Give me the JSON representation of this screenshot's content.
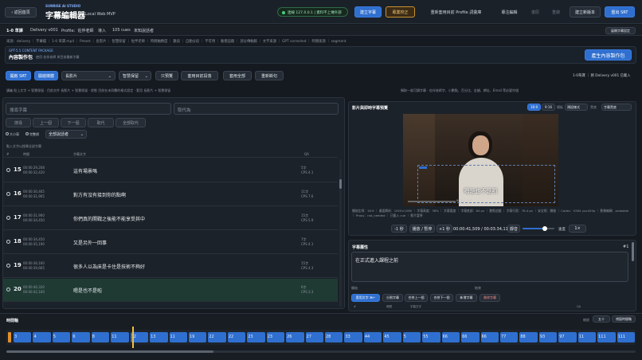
{
  "topbar": {
    "back": "‹ 返回首頁",
    "studio": "SUNRISE AI STUDIO",
    "title": "字幕編輯器",
    "subtitle": "Local Web MVP",
    "status": "連線 127.0.0.1 | 資料不上傳外部",
    "buttons": [
      "建立字幕",
      "專業校正",
      "重新套用目前 Profile 詞彙庫",
      "專注編輯",
      "復原",
      "重做",
      "建立新版本",
      "匯出 SRT"
    ]
  },
  "bar2": {
    "items": [
      "1-0 草譯",
      "Delivery v001",
      "Profile：佐伴老師",
      "導入",
      "105 cues",
      "未知說話者"
    ],
    "right": "展開字幕設定"
  },
  "bar3": {
    "text": "來源：delivery ｜ 字幕檔 ｜ 1-0 草譯.mp4 ｜ Preset ｜ 長影片 ｜ 智慧保留 ｜ 佐伴老師 ｜ 時間軸精度 ｜ 數段 ｜ 自動分段 ｜ 不可用 ｜ 動態追蹤 ｜ 部分傳輸稿 ｜ 文字來源 ｜ GPT corrected ｜ 時間來源 ｜ segment"
  },
  "content": {
    "label": "GPT-5.5 CONTENT PACKAGE",
    "title": "內容製作包",
    "desc": "使用 佐伴老師 與目前最新字幕",
    "button": "產生內容製作包"
  },
  "toolbar": {
    "b1": "開啟 SRT",
    "b2": "開啟媒體",
    "preset": "長影片",
    "keep": "智慧保留",
    "b3": "只預覽",
    "b4": "套用目前段落",
    "b5": "套用全部",
    "b6": "重新斷句",
    "right": "1-0草譯 ｜ 將 Delivery v001 已載入"
  },
  "info": {
    "text": "講義  貼上文字 + 智慧保留  ·  目前文件  長影片 + 智慧保留  ·  狀態  目前在未同覆的格式設定  ·  套用 長影片 + 智慧保留",
    "right": "擷取一般可讀字幕  ·  佐伴老師字、小數點、百分比、金額、網址、Email 等必要符號"
  },
  "search": {
    "placeholder": "搜尋字幕",
    "replace": "取代為",
    "b1": "搜尋",
    "b2": "上一個",
    "b3": "下一個",
    "b4": "取代",
    "b5": "全部取代",
    "opt1": "大小寫",
    "opt2": "完整詞",
    "speaker": "全部說話者",
    "hint": "點入文字以搜尋全部字幕"
  },
  "listhead": {
    "c1": "#",
    "c2": "時間",
    "c3": "字幕文字",
    "c4": "QA"
  },
  "rows": [
    {
      "n": "15",
      "s": "00:00:29,208",
      "e": "00:00:32,420",
      "t": "這有場景嗎",
      "q1": "5字",
      "q2": "CPS 4.1"
    },
    {
      "n": "16",
      "s": "00:00:30,465",
      "e": "00:00:31,905",
      "t": "對方有沒有接到你的點啊",
      "q1": "11字",
      "q2": "CPS 7.6"
    },
    {
      "n": "17",
      "s": "00:00:31,900",
      "e": "00:00:34,450",
      "t": "你們真的開戰之後能不能享受其中",
      "q1": "15字",
      "q2": "CPS 5.9"
    },
    {
      "n": "18",
      "s": "00:00:34,450",
      "e": "00:00:35,190",
      "t": "又是另外一回事",
      "q1": "7字",
      "q2": "CPS 4.1"
    },
    {
      "n": "19",
      "s": "00:00:36,160",
      "e": "00:00:39,665",
      "t": "很多人以為床是卡住是技術不夠好",
      "q1": "15字",
      "q2": "CPS 4.3"
    },
    {
      "n": "20",
      "s": "00:00:40,320",
      "e": "00:00:42,160",
      "t": "嗯是也不是啦",
      "q1": "6字",
      "q2": "CPS 3.3"
    }
  ],
  "video": {
    "title": "影片與即時字幕預覽",
    "tabs": [
      "16:9",
      "9:16"
    ],
    "label1": "模板",
    "sel1": "預設樣式",
    "label2": "黑底",
    "sel2": "字幕黑底",
    "subtitle": "嗯是也不是啦",
    "time_small": "0:20 / 0:44",
    "meta": "播放比例：16:9 ｜ 畫面解析：1920×1080 ｜ 字幕高度：38% ｜ 字幕寬度 ｜ 字幕底部：84 px ｜ 動態追蹤 ｜ 字幕行距：76.4 px ｜ 安全框：開啟 ｜ Codec：h264 yuv420p ｜ 影像編碼：probable ｜ Proxy：not_needed ｜ 已載入 cue ｜ 影片暫停",
    "b_back": "-1 秒",
    "b_play": "播放 / 暫停",
    "b_fwd": "+1 秒",
    "timecode": "00:00:41,509 / 00:03:34,114",
    "mute": "靜音",
    "speed_label": "速度",
    "speed": "1×",
    "volume": 0.7
  },
  "attr": {
    "title": "字幕屬性",
    "num": "#1",
    "text": "在正式進入課程之前",
    "l1": "開始",
    "l2": "結束",
    "b1": "套用文字 ⌘↵",
    "b2": "分割字幕",
    "b3": "合併上一個",
    "b4": "合併下一個",
    "b5": "新增字幕",
    "b6": "刪除字幕",
    "c1": "#",
    "c2": "時間",
    "c3": "字幕文字",
    "c4": "QA"
  },
  "timeline": {
    "title": "時間軸",
    "zoom_label": "縮放",
    "zoom": "五十",
    "b": "視窗時間軸",
    "segs": [
      "3",
      "4",
      "5",
      "6",
      "8",
      "11",
      "12",
      "13",
      "11",
      "19",
      "22",
      "22",
      "23",
      "23",
      "26",
      "27",
      "28",
      "33",
      "44",
      "45",
      "5",
      "55",
      "66",
      "66",
      "66",
      "77",
      "88",
      "93",
      "97",
      "11",
      "111",
      "111"
    ],
    "progress": 0.2
  }
}
